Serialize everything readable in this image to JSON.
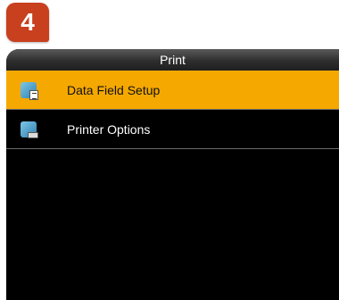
{
  "step_badge": "4",
  "header": {
    "title": "Print"
  },
  "menu": {
    "items": [
      {
        "label": "Data Field Setup",
        "icon": "data-field-icon",
        "selected": true
      },
      {
        "label": "Printer Options",
        "icon": "printer-icon",
        "selected": false
      }
    ]
  },
  "colors": {
    "selection": "#f5a800",
    "badge": "#c8401e",
    "screen_bg": "#000000"
  }
}
